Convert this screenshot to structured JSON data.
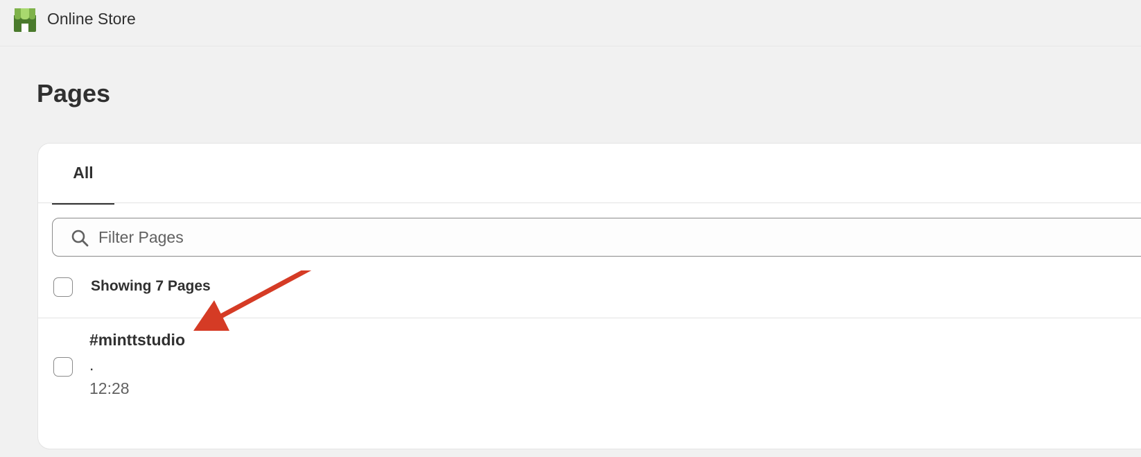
{
  "topbar": {
    "app_title": "Online Store",
    "icon": "store-icon"
  },
  "page": {
    "title": "Pages"
  },
  "tabs": [
    {
      "label": "All",
      "selected": true
    }
  ],
  "search": {
    "placeholder": "Filter Pages",
    "value": "",
    "icon": "search-icon"
  },
  "list": {
    "summary": "Showing 7 Pages",
    "rows": [
      {
        "title": "#minttstudio",
        "excerpt": ".",
        "time": "12:28"
      }
    ]
  },
  "annotation": {
    "type": "arrow",
    "color": "#d53b25"
  },
  "colors": {
    "background": "#f1f1f1",
    "card": "#ffffff",
    "text": "#303030",
    "muted": "#616161",
    "store_icon_green": "#4a7a2c",
    "store_icon_light": "#a8d86e"
  }
}
